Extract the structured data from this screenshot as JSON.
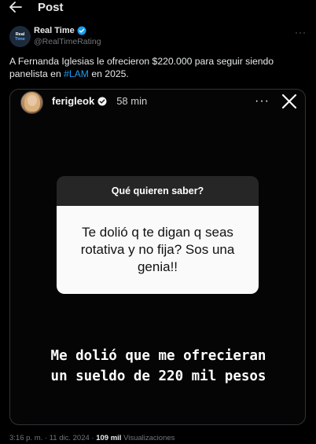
{
  "header": {
    "title": "Post",
    "back_icon": "arrow-left-icon"
  },
  "author": {
    "avatar_line1": "Real",
    "avatar_line2": "Time",
    "name": "Real Time",
    "handle": "@RealTimeRating",
    "verified_icon": "verified-badge-icon",
    "more_label": "···"
  },
  "tweet": {
    "text_before": "A Fernanda Iglesias le ofrecieron $220.000 para seguir siendo panelista en ",
    "hashtag": "#LAM",
    "text_after": " en 2025."
  },
  "story": {
    "username": "ferigleok",
    "time": "58 min",
    "dots": "···",
    "question_title": "Qué quieren saber?",
    "question_text": "Te dolió q te digan q seas rotativa y no fija? Sos una genia!!",
    "answer_line1": "Me dolió que me ofrecieran",
    "answer_line2": "un sueldo de 220 mil pesos"
  },
  "meta": {
    "time": "3:16 p. m.",
    "sep1": " · ",
    "date": "11 dic. 2024",
    "sep2": " · ",
    "views_count": "109 mil",
    "views_label": " Visualizaciones"
  },
  "colors": {
    "accent": "#1d9bf0",
    "background": "#000000",
    "muted": "#71767b"
  }
}
